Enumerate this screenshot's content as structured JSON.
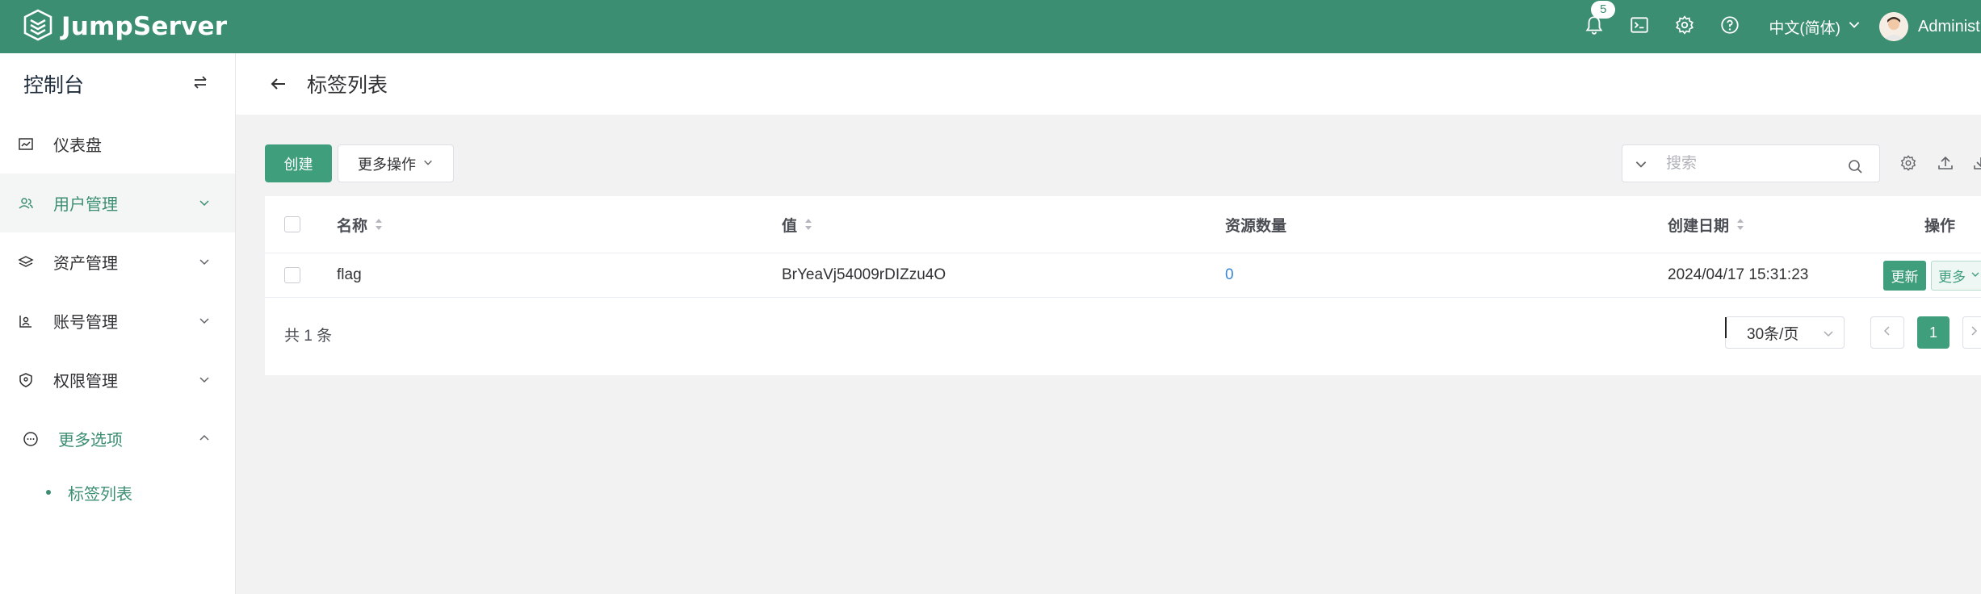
{
  "app": {
    "name": "JumpServer",
    "notification_count": "5",
    "language": "中文(简体)",
    "username": "Administrator"
  },
  "icons": {
    "logo": "jumpserver-logo-icon",
    "bell": "bell-icon",
    "terminal": "terminal-icon",
    "settings": "gear-icon",
    "help": "help-icon"
  },
  "sidebar": {
    "title": "控制台",
    "items": [
      {
        "label": "仪表盘",
        "icon": "dashboard-icon"
      },
      {
        "label": "用户管理",
        "icon": "users-icon"
      },
      {
        "label": "资产管理",
        "icon": "layers-icon"
      },
      {
        "label": "账号管理",
        "icon": "account-icon"
      },
      {
        "label": "权限管理",
        "icon": "shield-icon"
      },
      {
        "label": "更多选项",
        "icon": "more-icon"
      }
    ],
    "subitems": [
      {
        "label": "标签列表"
      }
    ]
  },
  "page": {
    "title": "标签列表"
  },
  "toolbar": {
    "create_label": "创建",
    "more_ops_label": "更多操作",
    "search_placeholder": "搜索"
  },
  "table": {
    "columns": [
      "名称",
      "值",
      "资源数量",
      "创建日期",
      "操作"
    ],
    "rows": [
      {
        "name": "flag",
        "value": "BrYeaVj54009rDIZzu4O",
        "resource_count": "0",
        "created": "2024/04/17 15:31:23",
        "update_label": "更新",
        "more_label": "更多"
      }
    ]
  },
  "pagination": {
    "total_text": "共 1 条",
    "page_size": "30条/页",
    "current_page": "1"
  },
  "colors": {
    "brand": "#3b8e72",
    "primary_button": "#3f9f7c",
    "link": "#3a87d8"
  }
}
